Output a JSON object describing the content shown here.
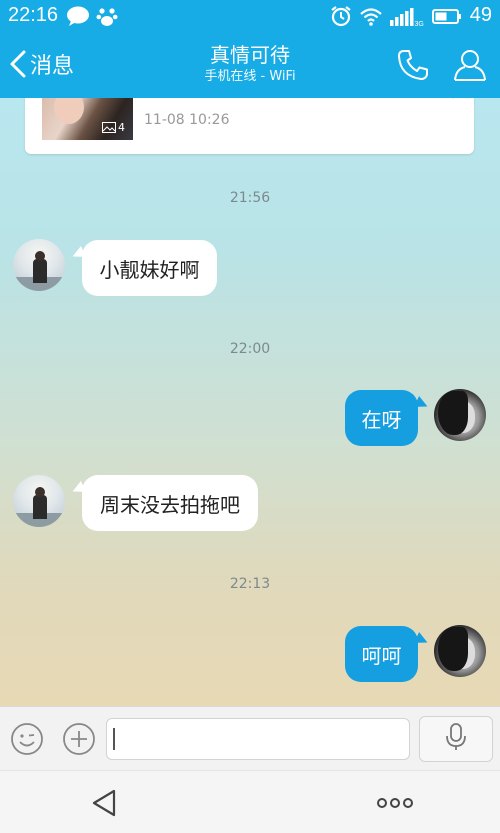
{
  "status_bar": {
    "time": "22:16",
    "battery": "49",
    "network": "3G"
  },
  "header": {
    "back_label": "消息",
    "title": "真情可待",
    "subtitle": "手机在线 - WiFi"
  },
  "prev_card": {
    "photo_count": "4",
    "timestamp": "11-08 10:26"
  },
  "messages": [
    {
      "type": "timestamp",
      "text": "21:56"
    },
    {
      "type": "received",
      "text": "小靓妹好啊"
    },
    {
      "type": "timestamp",
      "text": "22:00"
    },
    {
      "type": "sent",
      "text": "在呀"
    },
    {
      "type": "received",
      "text": "周末没去拍拖吧"
    },
    {
      "type": "timestamp",
      "text": "22:13"
    },
    {
      "type": "sent",
      "text": "呵呵"
    }
  ],
  "input": {
    "value": "",
    "placeholder": ""
  },
  "icons": {
    "status": [
      "message-icon",
      "paw-icon",
      "alarm-icon",
      "wifi-icon",
      "signal-icon",
      "battery-icon"
    ],
    "header": [
      "back-chevron-icon",
      "phone-icon",
      "profile-icon"
    ],
    "input": [
      "emoji-icon",
      "plus-icon",
      "mic-icon"
    ],
    "nav": [
      "nav-back-icon",
      "more-icon"
    ]
  },
  "colors": {
    "accent": "#17ace5",
    "sent_bubble": "#169fe0",
    "received_bubble": "#ffffff"
  }
}
